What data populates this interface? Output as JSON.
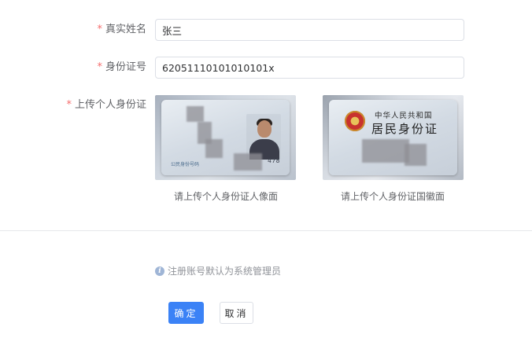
{
  "form": {
    "real_name": {
      "label": "真实姓名",
      "value": "张三"
    },
    "id_number": {
      "label": "身份证号",
      "value": "62051110101010101x"
    },
    "upload": {
      "label": "上传个人身份证",
      "front_caption": "请上传个人身份证人像面",
      "back_caption": "请上传个人身份证国徽面"
    },
    "required_mark": "*"
  },
  "id_card_images": {
    "front_number_fragment": "478",
    "front_small_text": "公民身份号码",
    "back_title_line1": "中华人民共和国",
    "back_title_line2": "居民身份证"
  },
  "hint": {
    "icon": "info-icon",
    "text": "注册账号默认为系统管理员"
  },
  "actions": {
    "confirm_label": "确定",
    "cancel_label": "取消"
  },
  "colors": {
    "primary": "#3b82f6",
    "required": "#f56c6c"
  }
}
